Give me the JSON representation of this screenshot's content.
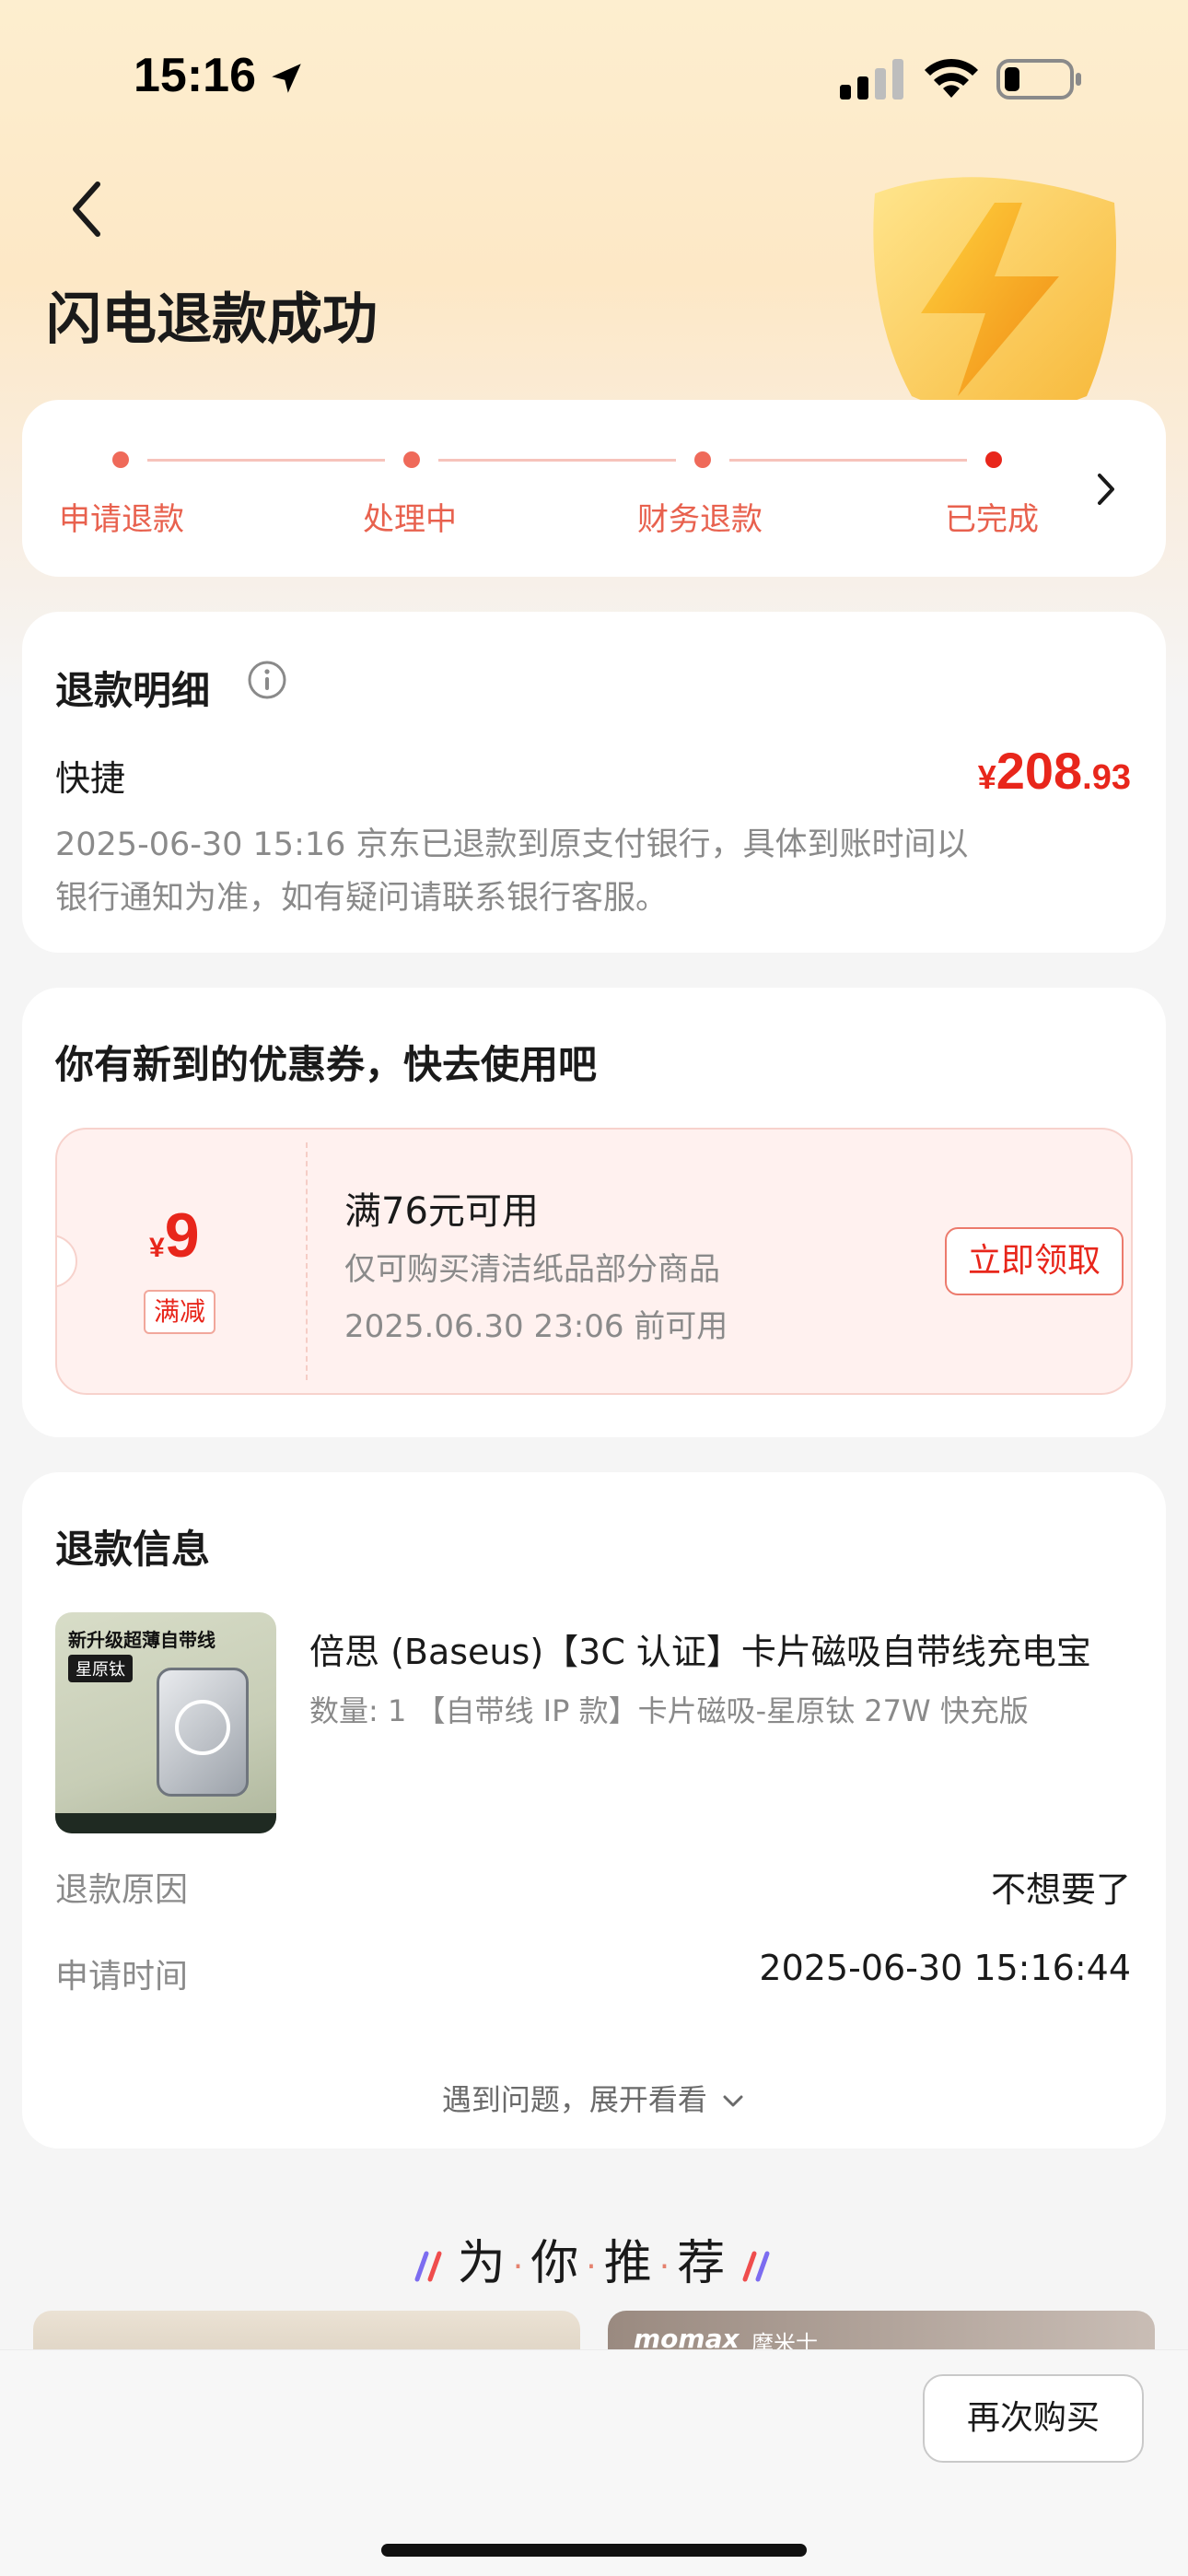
{
  "status_bar": {
    "time": "15:16"
  },
  "header": {
    "title": "闪电退款成功"
  },
  "progress": {
    "steps": [
      {
        "label": "申请退款"
      },
      {
        "label": "处理中"
      },
      {
        "label": "财务退款"
      },
      {
        "label": "已完成"
      }
    ],
    "current_step": 4,
    "colors": {
      "dot": "#ef6a5a",
      "active_dot": "#e8261b",
      "line": "#f6c3bb",
      "label": "#e8614e"
    }
  },
  "refund_detail": {
    "title": "退款明细",
    "method": "快捷",
    "currency": "¥",
    "amount_int": "208",
    "amount_dec": ".93",
    "desc": "2025-06-30 15:16 京东已退款到原支付银行，具体到账时间以银行通知为准，如有疑问请联系银行客服。"
  },
  "coupon_section": {
    "title": "你有新到的优惠券，快去使用吧",
    "coupon": {
      "currency": "¥",
      "value": "9",
      "tag": "满减",
      "condition": "满76元可用",
      "scope": "仅可购买清洁纸品部分商品",
      "valid_until": "2025.06.30 23:06 前可用",
      "button": "立即领取"
    }
  },
  "refund_info": {
    "title": "退款信息",
    "product": {
      "title": "倍思 (Baseus)【3C 认证】卡片磁吸自带线充电宝",
      "spec": "数量: 1 【自带线 IP 款】卡片磁吸-星原钛  27W 快充版",
      "image_text_1": "新升级超薄自带线",
      "image_text_2": "星原钛"
    },
    "reason_label": "退款原因",
    "reason_value": "不想要了",
    "time_label": "申请时间",
    "time_value": "2025-06-30 15:16:44",
    "expand": "遇到问题，展开看看"
  },
  "recommend": {
    "title_chars": [
      "为",
      "你",
      "推",
      "荐"
    ],
    "right_card_brand": "momax",
    "right_card_brand_cn": "摩米士"
  },
  "bottom_bar": {
    "rebuy": "再次购买"
  }
}
